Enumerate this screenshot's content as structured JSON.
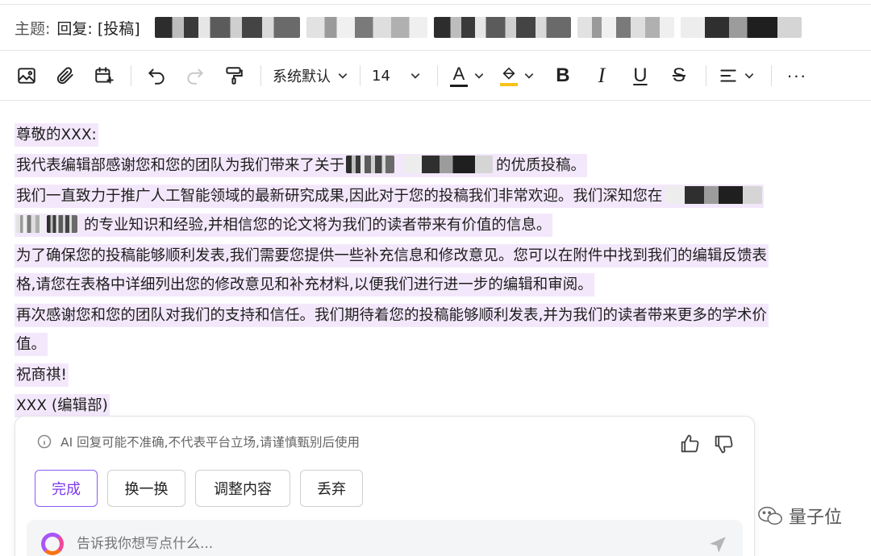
{
  "subject": {
    "label": "主题:",
    "reply_prefix": "回复:",
    "text": "[投稿]"
  },
  "toolbar": {
    "font_family": "系统默认",
    "font_size": "14",
    "font_color_letter": "A",
    "text_color": "#1f1f1f",
    "highlight_color": "#f6c21c",
    "bold": "B",
    "italic": "I",
    "underline": "U",
    "strikethrough": "S",
    "more": "···"
  },
  "email_body": {
    "greeting": "尊敬的XXX:",
    "p1_start": "我代表编辑部感谢您和您的团队为我们带来了关于",
    "p1_end": "的优质投稿。",
    "p2_line1": "我们一直致力于推广人工智能领域的最新研究成果,因此对于您的投稿我们非常欢迎。我们深知您在",
    "p2_line2_end": "的专业知识和经验,并相信您的论文将为我们的读者带来有价值的信息。",
    "p3_line1": "为了确保您的投稿能够顺利发表,我们需要您提供一些补充信息和修改意见。您可以在附件中找到我们的编辑反馈表",
    "p3_line2": "格,请您在表格中详细列出您的修改意见和补充材料,以便我们进行进一步的编辑和审阅。",
    "p4_line1": "再次感谢您和您的团队对我们的支持和信任。我们期待着您的投稿能够顺利发表,并为我们的读者带来更多的学术价",
    "p4_line2": "值。",
    "closing": "祝商祺!",
    "signature": "XXX (编辑部)"
  },
  "ai_panel": {
    "notice": "AI 回复可能不准确,不代表平台立场,请谨慎甄别后使用",
    "actions": [
      "完成",
      "换一换",
      "调整内容",
      "丢弃"
    ],
    "input_placeholder": "告诉我你想写点什么...",
    "accent_color": "#8b5cf6"
  },
  "watermark": {
    "text": "量子位"
  }
}
